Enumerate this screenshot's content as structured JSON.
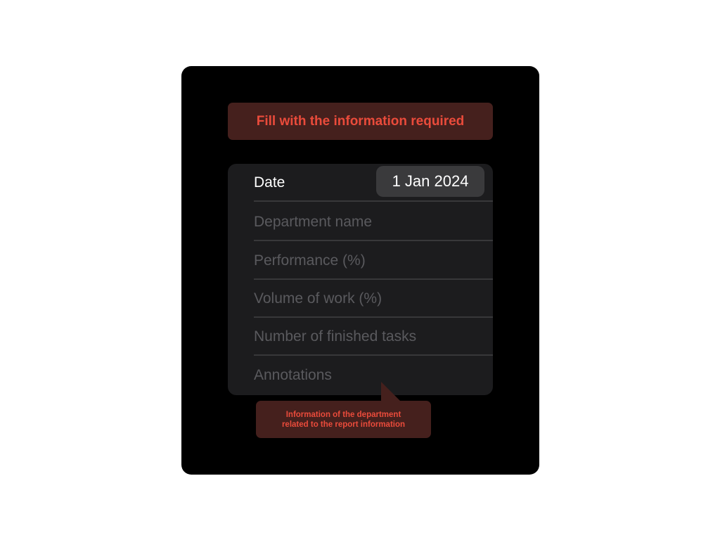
{
  "banner": {
    "text": "Fill with the information required"
  },
  "form": {
    "date": {
      "label": "Date",
      "value": "1 Jan 2024"
    },
    "fields": [
      {
        "placeholder": "Department name"
      },
      {
        "placeholder": "Performance (%)"
      },
      {
        "placeholder": "Volume of work (%)"
      },
      {
        "placeholder": "Number of finished tasks"
      },
      {
        "placeholder": "Annotations"
      }
    ]
  },
  "tooltip": {
    "line1": "Information of the department",
    "line2": "related to the report information"
  },
  "colors": {
    "panel_background": "#000000",
    "form_background": "#1c1c1e",
    "accent_red": "#ea4b3b",
    "callout_background": "#45201d",
    "date_pill_background": "#3a3a3c",
    "placeholder_text": "#5a5a5e"
  }
}
